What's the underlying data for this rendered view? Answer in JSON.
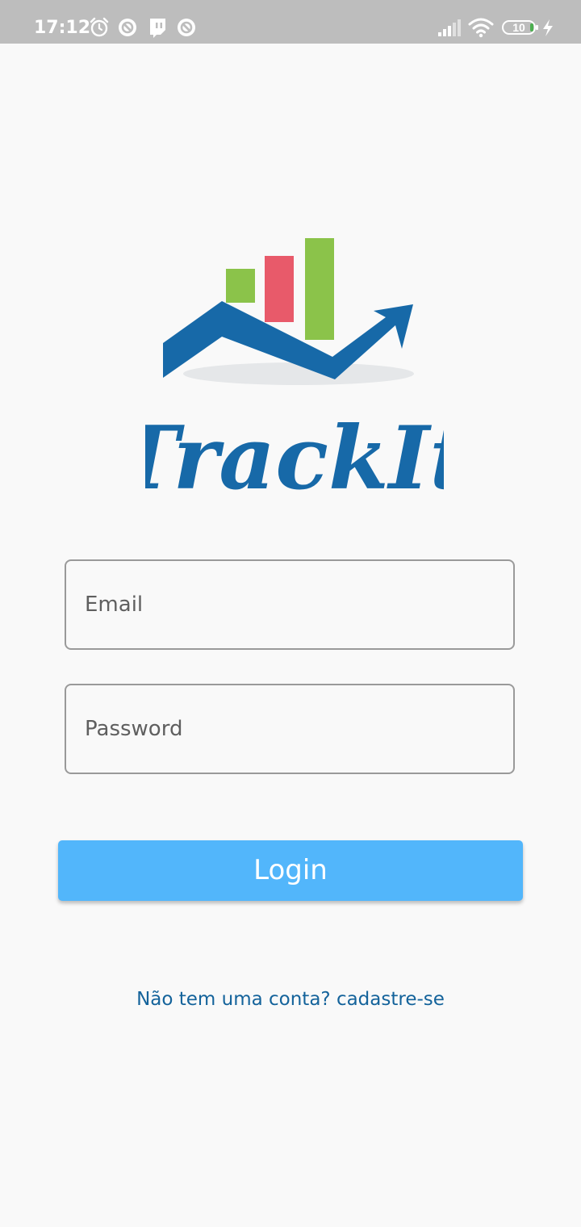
{
  "status_bar": {
    "time": "17:12",
    "battery_level": "10",
    "icons": [
      "alarm-icon",
      "app-notification-icon",
      "twitch-icon",
      "app-notification-icon",
      "signal-icon",
      "wifi-icon",
      "battery-icon",
      "charging-icon"
    ]
  },
  "logo": {
    "text": "TrackIt",
    "colors": {
      "blue": "#1769a8",
      "red": "#e85a6a",
      "green": "#8bc34a",
      "shadow": "#e5e7e9"
    }
  },
  "form": {
    "email_placeholder": "Email",
    "password_placeholder": "Password",
    "login_label": "Login"
  },
  "signup": {
    "text": "Não tem uma conta? cadastre-se"
  },
  "colors": {
    "accent": "#52b6fb",
    "link": "#14639b",
    "background": "#f9f9f9",
    "status_bar": "#bdbdbd"
  }
}
